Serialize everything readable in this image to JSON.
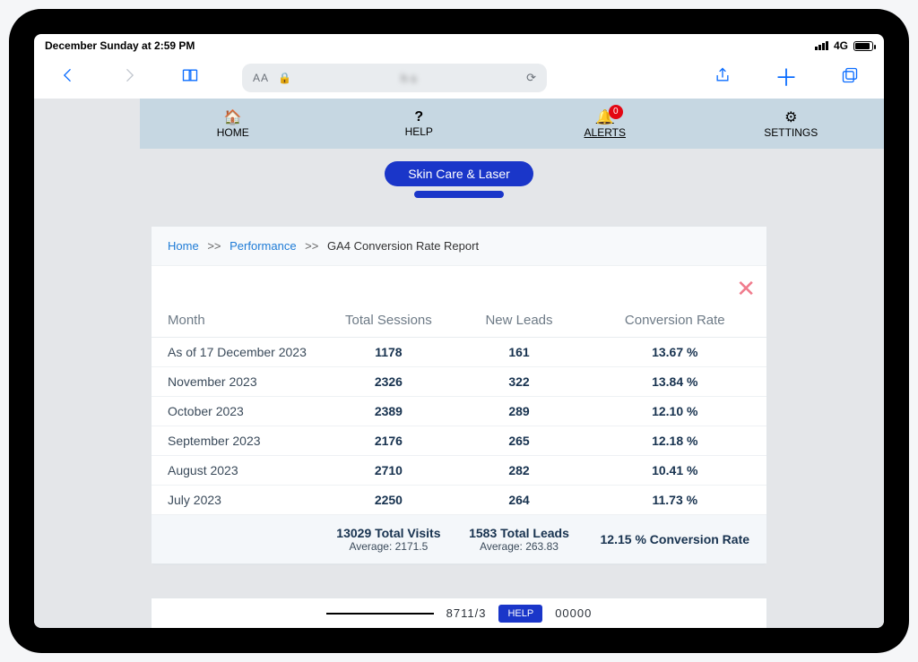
{
  "status": {
    "datetime": "December Sunday at 2:59 PM",
    "network": "4G"
  },
  "safari": {
    "aa": "AA",
    "domain": "h                    s"
  },
  "nav": {
    "home": "HOME",
    "help": "HELP",
    "alerts": "ALERTS",
    "settings": "SETTINGS",
    "alert_count": "0"
  },
  "business": {
    "pill1_blur_left": "        ",
    "pill1_text": "Skin Care & Laser",
    "pill1_blur_right": "      ",
    "pill2_blur": "                              "
  },
  "breadcrumb": {
    "home": "Home",
    "performance": "Performance",
    "current": "GA4 Conversion Rate Report",
    "sep": ">>"
  },
  "table": {
    "headers": {
      "month": "Month",
      "sessions": "Total Sessions",
      "leads": "New Leads",
      "rate": "Conversion Rate"
    },
    "rows": [
      {
        "month": "As of 17 December 2023",
        "sessions": "1178",
        "leads": "161",
        "rate": "13.67 %"
      },
      {
        "month": "November 2023",
        "sessions": "2326",
        "leads": "322",
        "rate": "13.84 %"
      },
      {
        "month": "October 2023",
        "sessions": "2389",
        "leads": "289",
        "rate": "12.10 %"
      },
      {
        "month": "September 2023",
        "sessions": "2176",
        "leads": "265",
        "rate": "12.18 %"
      },
      {
        "month": "August 2023",
        "sessions": "2710",
        "leads": "282",
        "rate": "10.41 %"
      },
      {
        "month": "July 2023",
        "sessions": "2250",
        "leads": "264",
        "rate": "11.73 %"
      }
    ],
    "footer": {
      "visits": "13029 Total Visits",
      "visits_avg": "Average: 2171.5",
      "leads": "1583 Total Leads",
      "leads_avg": "Average: 263.83",
      "rate": "12.15 % Conversion Rate"
    }
  },
  "bottom": {
    "left": "8711/3",
    "help": "HELP",
    "right": "00000"
  },
  "chart_data": {
    "type": "table",
    "title": "GA4 Conversion Rate Report",
    "columns": [
      "Month",
      "Total Sessions",
      "New Leads",
      "Conversion Rate %"
    ],
    "rows": [
      [
        "As of 17 December 2023",
        1178,
        161,
        13.67
      ],
      [
        "November 2023",
        2326,
        322,
        13.84
      ],
      [
        "October 2023",
        2389,
        289,
        12.1
      ],
      [
        "September 2023",
        2176,
        265,
        12.18
      ],
      [
        "August 2023",
        2710,
        282,
        10.41
      ],
      [
        "July 2023",
        2250,
        264,
        11.73
      ]
    ],
    "totals": {
      "Total Sessions": 13029,
      "New Leads": 1583,
      "Conversion Rate %": 12.15
    },
    "averages": {
      "Total Sessions": 2171.5,
      "New Leads": 263.83
    }
  }
}
